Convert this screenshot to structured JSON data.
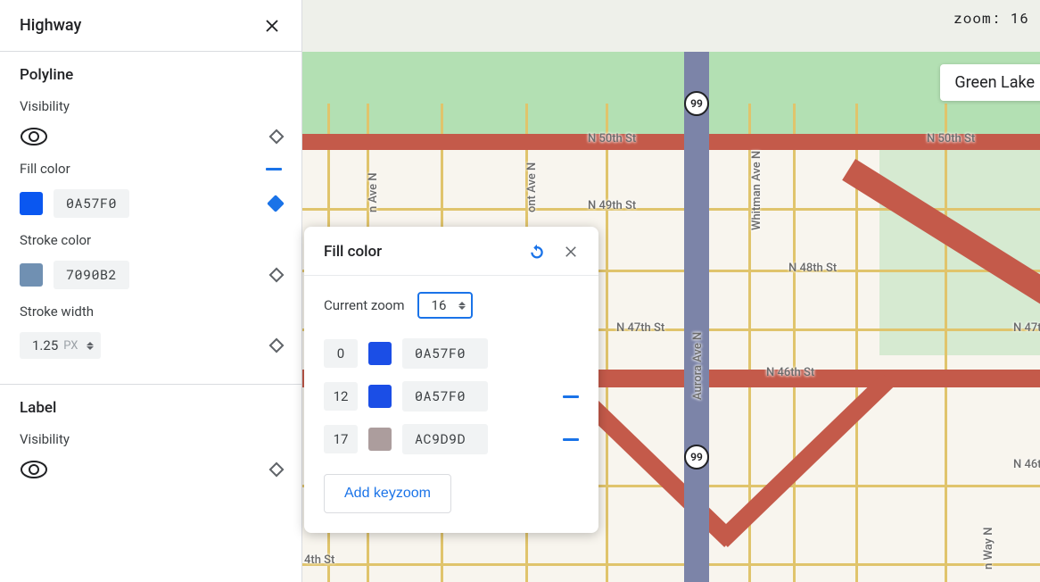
{
  "sidebar": {
    "title": "Highway",
    "polyline": {
      "title": "Polyline",
      "visibility_label": "Visibility",
      "fill_label": "Fill color",
      "fill_color": "#0A57F0",
      "fill_color_hex": "0A57F0",
      "stroke_label": "Stroke color",
      "stroke_color": "#7090B2",
      "stroke_color_hex": "7090B2",
      "width_label": "Stroke width",
      "width_value": "1.25",
      "width_unit": "PX"
    },
    "label_section": {
      "title": "Label",
      "visibility_label": "Visibility"
    }
  },
  "map": {
    "zoom_label": "zoom:",
    "zoom_value": "16",
    "place": "Green Lake",
    "route_shield": "99",
    "streets": {
      "n50": "N 50th St",
      "n50_b": "N 50th St",
      "n49": "N 49th St",
      "n48": "N 48th St",
      "n47": "N 47th St",
      "n46": "N 46th St",
      "thst": "4th St",
      "whitman": "Whitman Ave N",
      "aurora": "Aurora Ave N",
      "ont": "ont Ave N",
      "nave": "n Ave N",
      "nway": "n Way N"
    }
  },
  "popup": {
    "title": "Fill color",
    "current_zoom_label": "Current zoom",
    "current_zoom_value": "16",
    "keyzooms": [
      {
        "zoom": "0",
        "swatch": "#1B4EE6",
        "hex": "0A57F0"
      },
      {
        "zoom": "12",
        "swatch": "#1B4EE6",
        "hex": "0A57F0"
      },
      {
        "zoom": "17",
        "swatch": "#AC9D9D",
        "hex": "AC9D9D"
      }
    ],
    "add_label": "Add keyzoom"
  }
}
